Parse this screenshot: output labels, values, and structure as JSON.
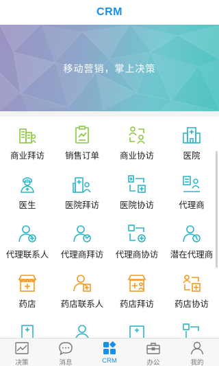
{
  "header": {
    "title": "CRM"
  },
  "banner": {
    "slogan": "移动营销，掌上决策"
  },
  "modules": [
    {
      "label": "商业拜访",
      "icon": "business-visit-icon",
      "color": "#8cc63f"
    },
    {
      "label": "销售订单",
      "icon": "sales-order-icon",
      "color": "#8cc63f"
    },
    {
      "label": "商业协访",
      "icon": "business-co-visit-icon",
      "color": "#8cc63f"
    },
    {
      "label": "医院",
      "icon": "hospital-icon",
      "color": "#2bb5c8"
    },
    {
      "label": "医生",
      "icon": "doctor-icon",
      "color": "#2bb5c8"
    },
    {
      "label": "医院拜访",
      "icon": "hospital-visit-icon",
      "color": "#2bb5c8"
    },
    {
      "label": "医院协访",
      "icon": "hospital-co-visit-icon",
      "color": "#2bb5c8"
    },
    {
      "label": "代理商",
      "icon": "agent-icon",
      "color": "#2bb5c8"
    },
    {
      "label": "代理联系人",
      "icon": "agent-contact-icon",
      "color": "#2bb5c8"
    },
    {
      "label": "代理商拜访",
      "icon": "agent-visit-icon",
      "color": "#2bb5c8"
    },
    {
      "label": "代理商协访",
      "icon": "agent-co-visit-icon",
      "color": "#2bb5c8"
    },
    {
      "label": "潜在代理商",
      "icon": "potential-agent-icon",
      "color": "#2bb5c8"
    },
    {
      "label": "药店",
      "icon": "pharmacy-icon",
      "color": "#f39a1e"
    },
    {
      "label": "药店联系人",
      "icon": "pharmacy-contact-icon",
      "color": "#f39a1e"
    },
    {
      "label": "药店拜访",
      "icon": "pharmacy-visit-icon",
      "color": "#f39a1e"
    },
    {
      "label": "药店协访",
      "icon": "pharmacy-co-visit-icon",
      "color": "#f39a1e"
    },
    {
      "label": "",
      "icon": "hospital-icon",
      "color": "#2bb5c8"
    },
    {
      "label": "",
      "icon": "user-icon",
      "color": "#2bb5c8"
    },
    {
      "label": "",
      "icon": "hospital-icon",
      "color": "#2bb5c8"
    },
    {
      "label": "",
      "icon": "flow-icon",
      "color": "#2bb5c8"
    }
  ],
  "tabbar": {
    "active_color": "#1b8fe6",
    "items": [
      {
        "label": "决策",
        "icon": "chart-icon"
      },
      {
        "label": "消息",
        "icon": "chat-bubble-icon"
      },
      {
        "label": "CRM",
        "icon": "crm-grid-icon",
        "active": true
      },
      {
        "label": "办公",
        "icon": "briefcase-icon"
      },
      {
        "label": "我的",
        "icon": "person-icon"
      }
    ]
  }
}
